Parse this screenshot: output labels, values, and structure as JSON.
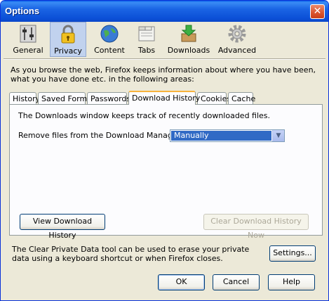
{
  "window": {
    "title": "Options",
    "close_glyph": "✕"
  },
  "toolbar": {
    "items": [
      {
        "label": "General",
        "icon": "switches-icon"
      },
      {
        "label": "Privacy",
        "icon": "padlock-icon",
        "selected": true
      },
      {
        "label": "Content",
        "icon": "globe-icon"
      },
      {
        "label": "Tabs",
        "icon": "tabs-icon"
      },
      {
        "label": "Downloads",
        "icon": "download-box-icon"
      },
      {
        "label": "Advanced",
        "icon": "gear-icon"
      }
    ]
  },
  "intro": "As you browse the web, Firefox keeps information about where you have been, what you have done etc. in the following areas:",
  "tabs": [
    "History",
    "Saved Forms",
    "Passwords",
    "Download History",
    "Cookies",
    "Cache"
  ],
  "active_tab": "Download History",
  "panel": {
    "description": "The Downloads window keeps track of recently downloaded files.",
    "remove_label": "Remove files from the Download Manager:",
    "remove_value": "Manually",
    "view_button": "View Download History",
    "clear_button": "Clear Download History Now"
  },
  "private_data_text": "The Clear Private Data tool can be used to erase your private data using a keyboard shortcut or when Firefox closes.",
  "settings_button": "Settings...",
  "buttons": {
    "ok": "OK",
    "cancel": "Cancel",
    "help": "Help"
  },
  "colors": {
    "titlebar": "#0b4fd6",
    "selection": "#316ac5",
    "tab_highlight": "#f8b33c",
    "dialog_bg": "#ece9d8"
  }
}
